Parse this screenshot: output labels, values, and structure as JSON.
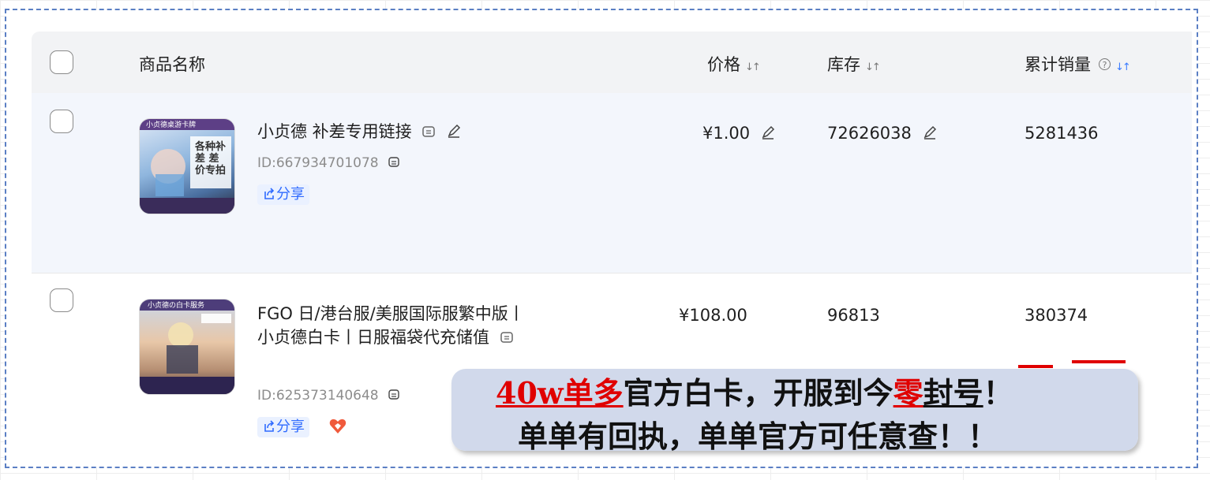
{
  "table": {
    "headers": {
      "product_name": "商品名称",
      "price": "价格",
      "stock": "库存",
      "sales": "累计销量",
      "sort_glyph": "↓↑",
      "help_glyph": "?"
    },
    "rows": [
      {
        "name": "小贞德 补差专用链接",
        "id": "ID:667934701078",
        "share": "分享",
        "price": "¥1.00",
        "stock": "72626038",
        "sales": "5281436",
        "thumb_caption": "小贞德桌游卡牌",
        "thumb_text": "各种补差 差价专拍"
      },
      {
        "name_line1": "FGO 日/港台服/美服国际服繁中版丨",
        "name_line2": "小贞德白卡丨日服福袋代充储值",
        "id": "ID:625373140648",
        "share": "分享",
        "price": "¥108.00",
        "stock": "96813",
        "sales": "380374",
        "thumb_caption": "小贞德の白卡服务"
      }
    ]
  },
  "overlay": {
    "line1_red1": "40w单多",
    "line1_mid": "官方白卡，开服到今",
    "line1_red2": "零",
    "line1_ul": "封号",
    "line1_end": "！",
    "line2": "单单有回执，单单官方可任意查！！"
  },
  "icons": [
    "copy-icon",
    "edit-icon",
    "share-icon",
    "heart-icon",
    "help-icon",
    "sort-icon"
  ],
  "colors": {
    "accent": "#2f6bff",
    "overlay_red": "#e00000",
    "header_bg": "#f2f3f5",
    "row_highlight": "#f3f6fc"
  }
}
